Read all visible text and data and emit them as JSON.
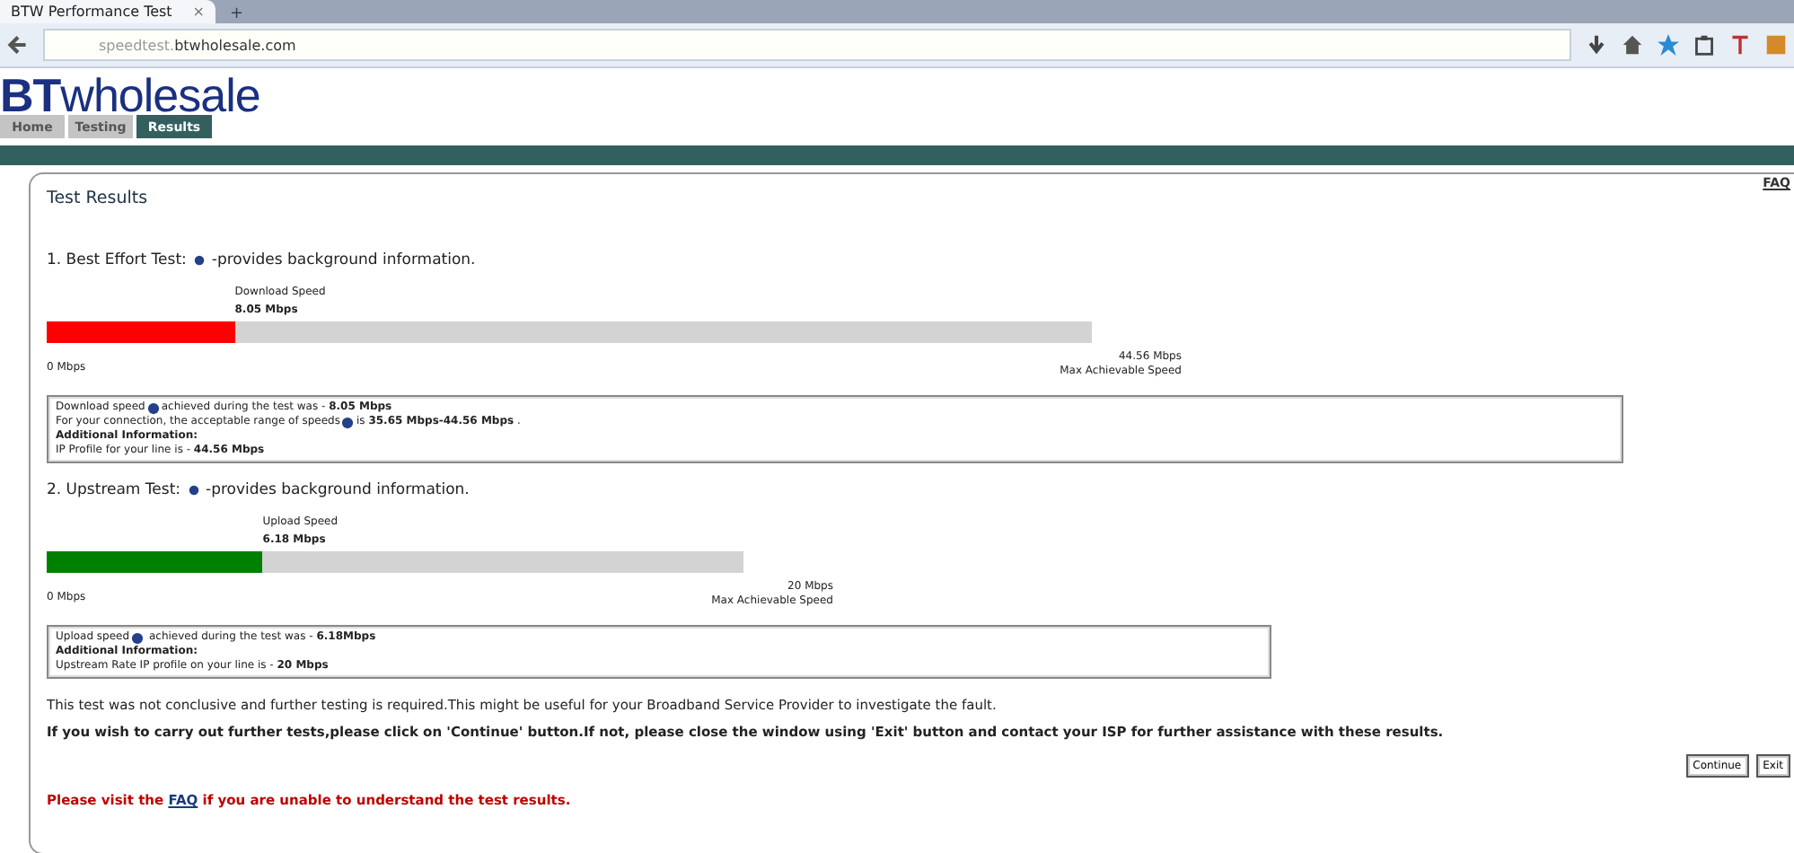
{
  "browser": {
    "tab_title": "BTW Performance Test",
    "tab_close": "×",
    "new_tab": "+",
    "url_prefix": "speedtest.",
    "url_domain": "btwholesale.com"
  },
  "logo": {
    "bold": "BT",
    "light": "wholesale"
  },
  "nav_tabs": [
    {
      "label": "Home",
      "selected": false
    },
    {
      "label": "Testing",
      "selected": false
    },
    {
      "label": "Results",
      "selected": true
    }
  ],
  "faq_top": "FAQ",
  "title": "Test Results",
  "tests": [
    {
      "kind": "download",
      "lead": "1. Best Effort Test:",
      "tail": "-provides background information.",
      "speed_label": "Download Speed",
      "speed_value": "8.05 Mbps",
      "level": 0.18,
      "color": "#ff0000",
      "min_label": "0 Mbps",
      "max_value": "44.56 Mbps",
      "max_label": "Max Achievable Speed",
      "info": [
        {
          "lead": "Download speed",
          "text": "achieved during the test was - **8.05 Mbps**"
        },
        {
          "lead": "For your connection, the acceptable range of speeds",
          "text": "is **35.65 Mbps-44.56 Mbps** ."
        },
        {
          "text": "**Additional Information:**"
        },
        {
          "text": "IP Profile for your line is - **44.56 Mbps**"
        }
      ]
    },
    {
      "kind": "upload",
      "lead": "2. Upstream Test:",
      "tail": "-provides background information.",
      "speed_label": "Upload Speed",
      "speed_value": "6.18 Mbps",
      "level": 0.31,
      "color": "#008000",
      "min_label": "0 Mbps",
      "max_value": "20 Mbps",
      "max_label": "Max Achievable Speed",
      "info": [
        {
          "lead": "Upload speed",
          "text": " achieved during the test was - **6.18Mbps**"
        },
        {
          "text": "**Additional Information:**"
        },
        {
          "text": "Upstream Rate IP profile on your line is - **20 Mbps**"
        }
      ]
    }
  ],
  "conclusion": "This test was not conclusive and further testing is required.This might be useful for your Broadband Service Provider to investigate the fault.",
  "instruction": "If you wish to carry out further tests,please click on 'Continue' button.If not, please close the window using 'Exit' button and contact your ISP for further assistance with these results.",
  "buttons": [
    "Continue",
    "Exit"
  ],
  "faq_notice": {
    "before": "Please visit the",
    "link": "FAQ",
    "after": "if you are unable to understand the test results."
  }
}
